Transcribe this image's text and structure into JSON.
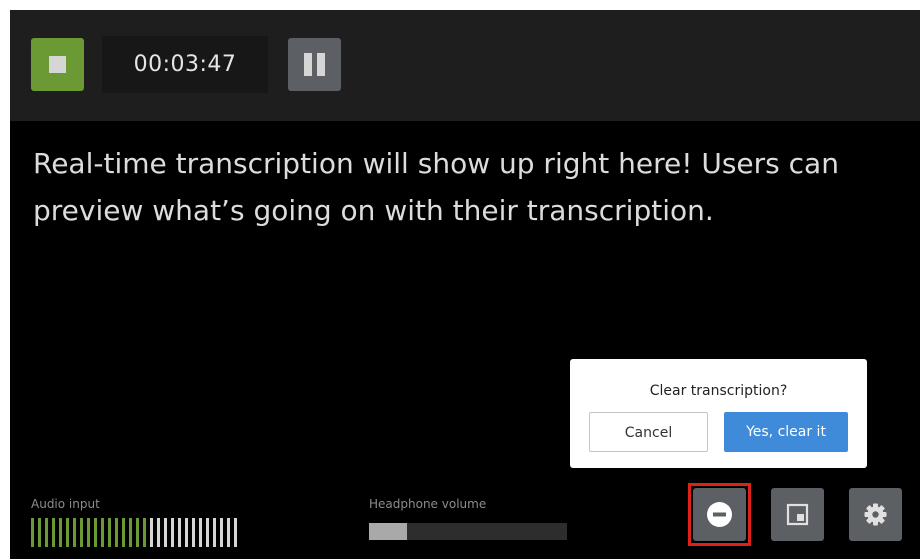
{
  "recording": {
    "timer": "00:03:47",
    "stop_icon": "stop-icon",
    "pause_icon": "pause-icon"
  },
  "transcript": {
    "text": "Real-time transcription will show up right here! Users can preview what’s going on with their transcription."
  },
  "dialog": {
    "title": "Clear transcription?",
    "cancel_label": "Cancel",
    "confirm_label": "Yes, clear it"
  },
  "meters": {
    "audio_input_label": "Audio input",
    "audio_input_level": 0.55,
    "headphone_label": "Headphone volume",
    "headphone_volume": 0.19
  },
  "controls": {
    "clear_icon": "minus-circle-icon",
    "pip_icon": "picture-in-picture-icon",
    "settings_icon": "gear-icon"
  },
  "colors": {
    "stop_accent": "#6b9a34",
    "meter_active": "#6b9a34",
    "meter_inactive": "#d6d6d6",
    "confirm_accent": "#3f8ad9",
    "highlight": "#e0201a"
  }
}
